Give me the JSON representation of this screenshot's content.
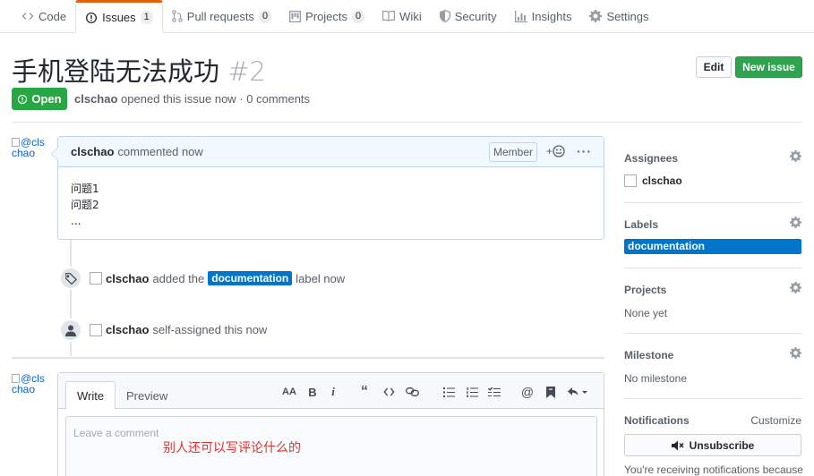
{
  "tabs": [
    {
      "label": "Code",
      "icon": "code-icon"
    },
    {
      "label": "Issues",
      "icon": "issue-opened-icon",
      "count": "1",
      "active": true
    },
    {
      "label": "Pull requests",
      "icon": "git-pull-request-icon",
      "count": "0"
    },
    {
      "label": "Projects",
      "icon": "project-icon",
      "count": "0"
    },
    {
      "label": "Wiki",
      "icon": "book-icon"
    },
    {
      "label": "Security",
      "icon": "shield-icon"
    },
    {
      "label": "Insights",
      "icon": "graph-icon"
    },
    {
      "label": "Settings",
      "icon": "gear-icon"
    }
  ],
  "issue": {
    "title": "手机登陆无法成功",
    "number": "#2",
    "state": "Open",
    "author": "clschao",
    "meta_rest": "opened this issue now · 0 comments"
  },
  "buttons": {
    "edit": "Edit",
    "new_issue": "New issue"
  },
  "comment": {
    "avatar_alt": "@clschao",
    "author": "clschao",
    "time": "commented now",
    "role": "Member",
    "reaction": "+",
    "body": [
      "问题1",
      "问题2",
      "..."
    ]
  },
  "timeline": [
    {
      "icon": "tag-icon",
      "actor": "clschao",
      "pre": "added the",
      "label": "documentation",
      "post": "label now"
    },
    {
      "icon": "person-icon",
      "actor": "clschao",
      "pre": "self-assigned this now"
    }
  ],
  "new_comment": {
    "avatar_alt": "@clschao",
    "write_tab": "Write",
    "preview_tab": "Preview",
    "placeholder": "Leave a comment",
    "typed_note": "别人还可以写评论什么的"
  },
  "sidebar": {
    "assignees": {
      "heading": "Assignees",
      "user": "clschao"
    },
    "labels": {
      "heading": "Labels",
      "label": "documentation",
      "label_color": "#0075ca"
    },
    "projects": {
      "heading": "Projects",
      "value": "None yet"
    },
    "milestone": {
      "heading": "Milestone",
      "value": "No milestone"
    },
    "notifications": {
      "heading": "Notifications",
      "customize": "Customize",
      "unsubscribe": "Unsubscribe",
      "note": "You're receiving notifications because"
    }
  },
  "colors": {
    "open_green": "#28a745",
    "new_issue_green": "#2ea44f",
    "active_tab_accent": "#e36209",
    "link_blue": "#0366d6"
  }
}
